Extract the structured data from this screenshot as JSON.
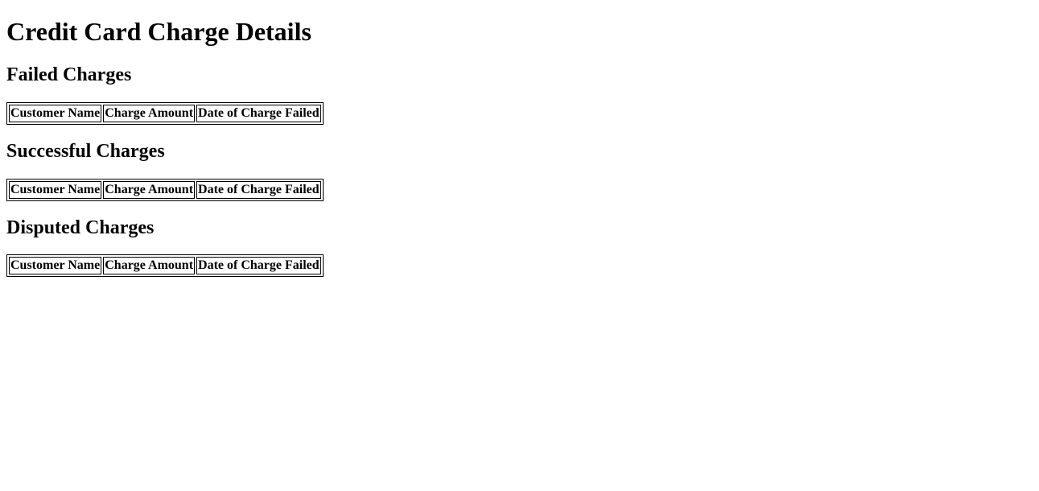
{
  "title": "Credit Card Charge Details",
  "sections": [
    {
      "heading": "Failed Charges",
      "columns": [
        "Customer Name",
        "Charge Amount",
        "Date of Charge Failed"
      ]
    },
    {
      "heading": "Successful Charges",
      "columns": [
        "Customer Name",
        "Charge Amount",
        "Date of Charge Failed"
      ]
    },
    {
      "heading": "Disputed Charges",
      "columns": [
        "Customer Name",
        "Charge Amount",
        "Date of Charge Failed"
      ]
    }
  ]
}
